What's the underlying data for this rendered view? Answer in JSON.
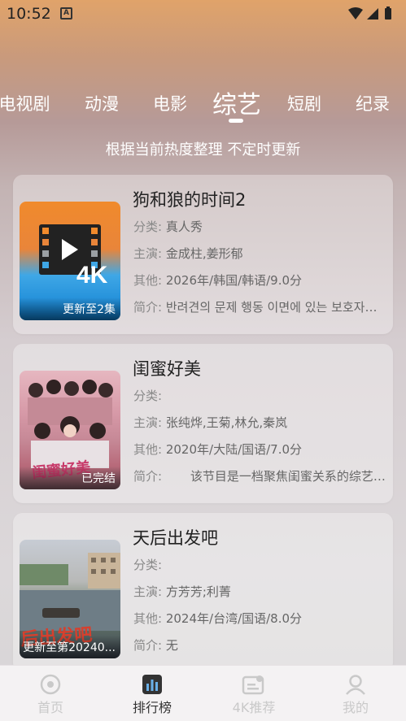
{
  "status_bar": {
    "time": "10:52",
    "notification_badge": "A"
  },
  "tabs": [
    {
      "label": "电视剧",
      "active": false
    },
    {
      "label": "动漫",
      "active": false
    },
    {
      "label": "电影",
      "active": false
    },
    {
      "label": "综艺",
      "active": true
    },
    {
      "label": "短剧",
      "active": false
    },
    {
      "label": "纪录",
      "active": false
    }
  ],
  "subtitle": "根据当前热度整理 不定时更新",
  "cards": [
    {
      "title": "狗和狼的时间2",
      "category_label": "分类:",
      "category": "真人秀",
      "cast_label": "主演:",
      "cast": "金成柱,姜形郁",
      "other_label": "其他:",
      "other": "2026年/韩国/韩语/9.0分",
      "intro_label": "简介:",
      "intro": "반려견의 문제 행동 이면에 있는 보호자의 이야기",
      "badge": "更新至2集",
      "poster": "4k-video-icon"
    },
    {
      "title": "闺蜜好美",
      "category_label": "分类:",
      "category": "",
      "cast_label": "主演:",
      "cast": "张纯烨,王菊,林允,秦岚",
      "other_label": "其他:",
      "other": "2020年/大陆/国语/7.0分",
      "intro_label": "简介:",
      "intro": "　　该节目是一档聚焦闺蜜关系的综艺节目",
      "badge": "已完结",
      "poster": "group-photo"
    },
    {
      "title": "天后出发吧",
      "category_label": "分类:",
      "category": "",
      "cast_label": "主演:",
      "cast": "方芳芳;利菁",
      "other_label": "其他:",
      "other": "2024年/台湾/国语/8.0分",
      "intro_label": "简介:",
      "intro": "无",
      "badge": "更新至第20240...",
      "poster": "river-town"
    }
  ],
  "bottom_nav": [
    {
      "label": "首页",
      "icon": "home-icon",
      "active": false
    },
    {
      "label": "排行榜",
      "icon": "ranking-icon",
      "active": true
    },
    {
      "label": "4K推荐",
      "icon": "4k-icon",
      "active": false
    },
    {
      "label": "我的",
      "icon": "profile-icon",
      "active": false
    }
  ],
  "colors": {
    "accent": "#ffffff",
    "text_dark": "#222222",
    "text_muted": "#666666",
    "nav_inactive": "#c9c9c9"
  }
}
